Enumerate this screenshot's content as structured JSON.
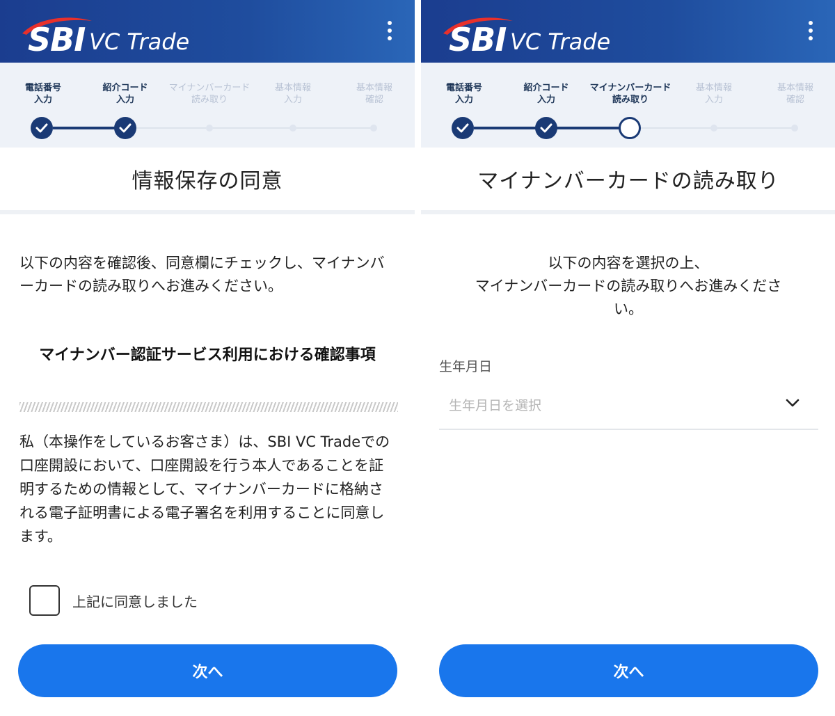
{
  "app": {
    "brand_sbi": "SBI",
    "brand_name": "VC Trade"
  },
  "colors": {
    "header": "#1f4d9e",
    "accent": "#1976ec",
    "stepper_active": "#1a3a75"
  },
  "left": {
    "steps": [
      {
        "label": "電話番号\n入力",
        "state": "done"
      },
      {
        "label": "紹介コード\n入力",
        "state": "done"
      },
      {
        "label": "マイナンバーカード\n読み取り",
        "state": "pending"
      },
      {
        "label": "基本情報\n入力",
        "state": "pending"
      },
      {
        "label": "基本情報\n確認",
        "state": "pending"
      }
    ],
    "title": "情報保存の同意",
    "intro": "以下の内容を確認後、同意欄にチェックし、マイナンバーカードの読み取りへお進みください。",
    "consent_heading": "マイナンバー認証サービス利用における確認事項",
    "consent_body": "私（本操作をしているお客さま）は、SBI VC Tradeでの口座開設において、口座開設を行う本人であることを証明するための情報として、マイナンバーカードに格納される電子証明書による電子署名を利用することに同意します。",
    "checkbox_label": "上記に同意しました",
    "next_button": "次へ"
  },
  "right": {
    "steps": [
      {
        "label": "電話番号\n入力",
        "state": "done"
      },
      {
        "label": "紹介コード\n入力",
        "state": "done"
      },
      {
        "label": "マイナンバーカード\n読み取り",
        "state": "current"
      },
      {
        "label": "基本情報\n入力",
        "state": "pending"
      },
      {
        "label": "基本情報\n確認",
        "state": "pending"
      }
    ],
    "title": "マイナンバーカードの読み取り",
    "intro_line1": "以下の内容を選択の上、",
    "intro_line2": "マイナンバーカードの読み取りへお進みくださ",
    "intro_line3": "い。",
    "field_label": "生年月日",
    "select_placeholder": "生年月日を選択",
    "next_button": "次へ"
  }
}
